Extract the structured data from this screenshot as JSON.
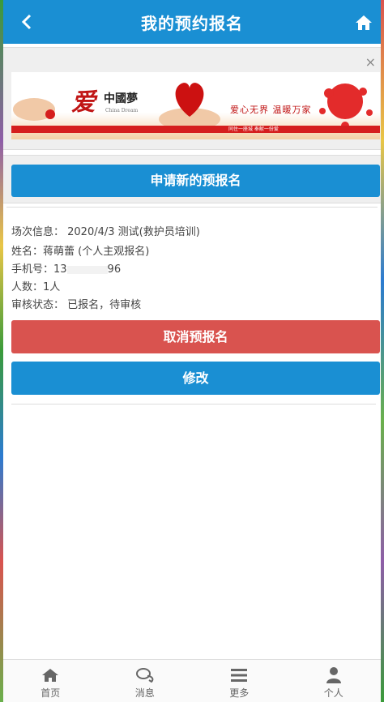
{
  "header": {
    "title": "我的预约报名",
    "back_icon": "chevron-left-icon",
    "home_icon": "home-icon"
  },
  "banner": {
    "close_label": "×",
    "logo_text": "爱",
    "logo_cn": "中國夢",
    "logo_en": "China Dream",
    "slogan": "爱心无界  温暖万家",
    "subline": "同住一座城    奉献一份爱"
  },
  "apply_button": "申请新的预报名",
  "details": {
    "session": "场次信息： 2020/4/3 测试(救护员培训)",
    "name": "姓名：蒋萌蕾 (个人主观报名)",
    "phone_prefix": "手机号：13",
    "phone_suffix": "96",
    "count": "人数：1人",
    "status": "审核状态： 已报名，待审核"
  },
  "cancel_button": "取消预报名",
  "edit_button": "修改",
  "tabbar": [
    {
      "label": "首页",
      "icon": "home-icon"
    },
    {
      "label": "消息",
      "icon": "chat-icon"
    },
    {
      "label": "更多",
      "icon": "menu-icon"
    },
    {
      "label": "个人",
      "icon": "user-icon"
    }
  ],
  "colors": {
    "primary": "#1a8fd3",
    "danger": "#d9534f"
  }
}
